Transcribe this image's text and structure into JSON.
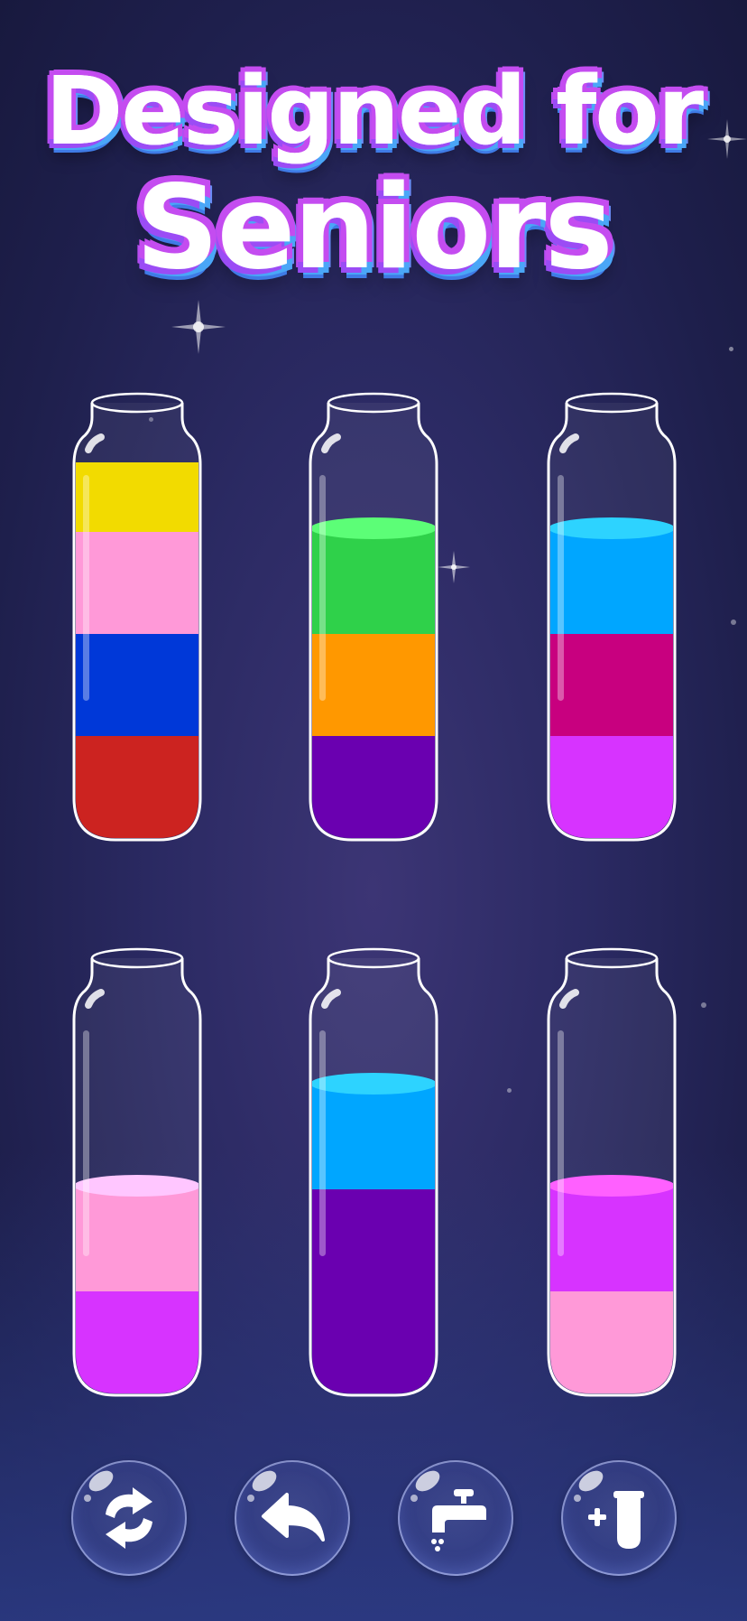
{
  "headline": {
    "line1": "Designed for",
    "line2": "Seniors"
  },
  "tubes": [
    {
      "id": 1,
      "layers": [
        "#cc2320",
        "#0038d8",
        "#ff99d8",
        "#f2db00"
      ]
    },
    {
      "id": 2,
      "layers": [
        "#6a00b0",
        "#ff9800",
        "#2fd14a"
      ]
    },
    {
      "id": 3,
      "layers": [
        "#d733ff",
        "#c8007f",
        "#00a6ff"
      ]
    },
    {
      "id": 4,
      "layers": [
        "#d733ff",
        "#ff99d8"
      ]
    },
    {
      "id": 5,
      "layers": [
        "#6a00b0",
        "#6a00b0",
        "#00a6ff"
      ]
    },
    {
      "id": 6,
      "layers": [
        "#ff99d8",
        "#d733ff"
      ]
    }
  ],
  "toolbar": [
    {
      "name": "restart-button",
      "icon": "refresh-icon"
    },
    {
      "name": "undo-button",
      "icon": "undo-arrow-icon"
    },
    {
      "name": "tap-button",
      "icon": "faucet-icon"
    },
    {
      "name": "add-tube-button",
      "icon": "add-tube-icon"
    }
  ]
}
